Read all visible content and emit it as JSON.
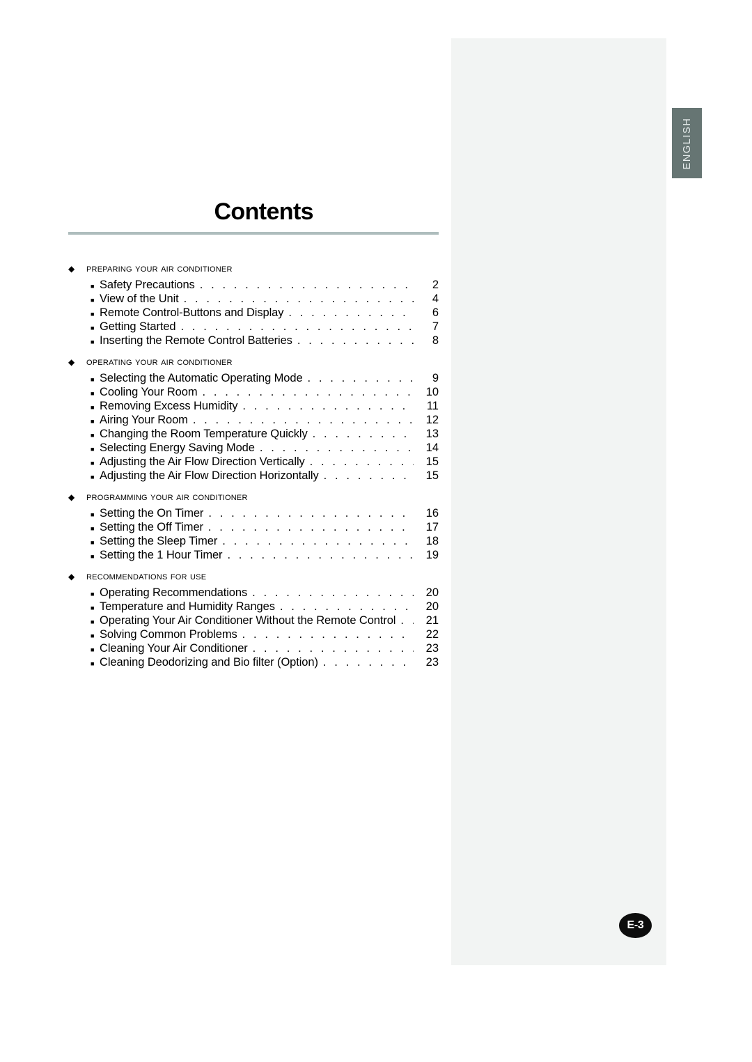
{
  "page": {
    "title": "Contents",
    "badge": "E-3",
    "language_tab": "ENGLISH",
    "rule_color": "#aebdbd",
    "tab_color": "#667573",
    "panel_color": "#f2f4f3"
  },
  "toc": {
    "sections": [
      {
        "label": "Preparing your air conditioner",
        "items": [
          {
            "title": "Safety Precautions",
            "page": "2"
          },
          {
            "title": "View of the Unit",
            "page": "4"
          },
          {
            "title": "Remote Control-Buttons and Display",
            "page": "6"
          },
          {
            "title": "Getting Started",
            "page": "7"
          },
          {
            "title": "Inserting the Remote Control Batteries",
            "page": "8"
          }
        ]
      },
      {
        "label": "Operating your air conditioner",
        "items": [
          {
            "title": "Selecting the Automatic Operating Mode",
            "page": "9"
          },
          {
            "title": "Cooling Your Room",
            "page": "10"
          },
          {
            "title": "Removing Excess Humidity",
            "page": "11"
          },
          {
            "title": "Airing Your Room",
            "page": "12"
          },
          {
            "title": "Changing the Room Temperature Quickly",
            "page": "13"
          },
          {
            "title": "Selecting Energy Saving Mode",
            "page": "14"
          },
          {
            "title": "Adjusting the Air Flow Direction Vertically",
            "page": "15"
          },
          {
            "title": "Adjusting the Air Flow Direction Horizontally",
            "page": "15"
          }
        ]
      },
      {
        "label": "Programming your air conditioner",
        "items": [
          {
            "title": "Setting the On Timer",
            "page": "16"
          },
          {
            "title": "Setting the Off Timer",
            "page": "17"
          },
          {
            "title": "Setting the Sleep Timer",
            "page": "18"
          },
          {
            "title": "Setting the 1 Hour Timer",
            "page": "19"
          }
        ]
      },
      {
        "label": "Recommendations for use",
        "items": [
          {
            "title": "Operating Recommendations",
            "page": "20"
          },
          {
            "title": "Temperature and Humidity Ranges",
            "page": "20"
          },
          {
            "title": "Operating Your Air Conditioner Without the Remote Control",
            "page": "21"
          },
          {
            "title": "Solving Common Problems",
            "page": "22"
          },
          {
            "title": "Cleaning Your Air Conditioner",
            "page": "23"
          },
          {
            "title": "Cleaning Deodorizing and Bio filter (Option)",
            "page": "23"
          }
        ]
      }
    ]
  },
  "glyphs": {
    "diamond": "◆",
    "square": "■",
    "leader_dots": ". . . . . . . . . . . . . . . . . . . . . . . . . . . . . . . . . . . . . . . . . . . . . . . . . . . . . . . . . . . . . . . . . . . . . . . . . ."
  }
}
